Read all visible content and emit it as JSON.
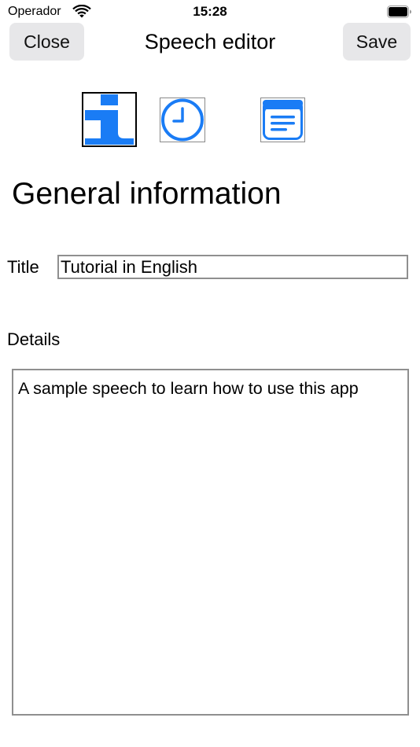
{
  "status_bar": {
    "carrier": "Operador",
    "time": "15:28",
    "wifi_icon": "wifi-icon",
    "battery_icon": "battery-icon"
  },
  "nav": {
    "title": "Speech editor",
    "close_label": "Close",
    "save_label": "Save"
  },
  "tabs": [
    {
      "icon": "info-icon",
      "selected": true
    },
    {
      "icon": "clock-icon",
      "selected": false
    },
    {
      "icon": "notes-icon",
      "selected": false
    }
  ],
  "section": {
    "heading": "General information"
  },
  "form": {
    "title_label": "Title",
    "title_value": "Tutorial in English",
    "details_label": "Details",
    "details_value": "A sample speech to learn how to use this app"
  },
  "colors": {
    "accent": "#1a7cf5",
    "button_bg": "#e7e7e9",
    "field_border": "#8f8f8f"
  }
}
